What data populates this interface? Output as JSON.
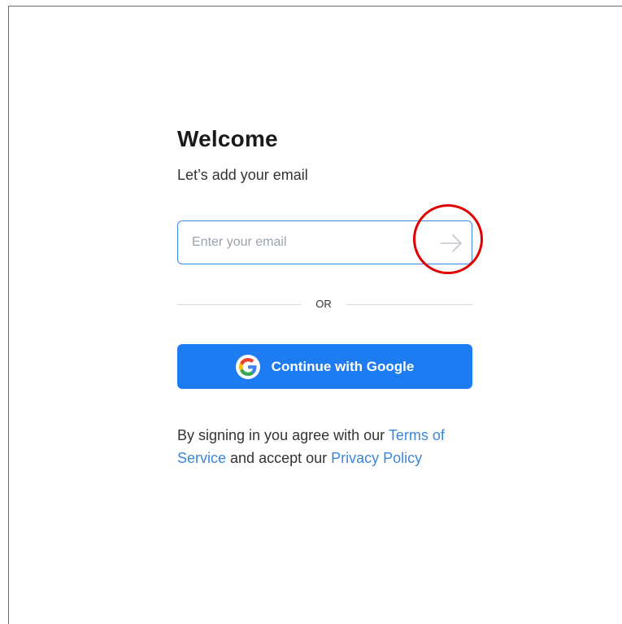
{
  "login": {
    "title": "Welcome",
    "subtitle": "Let’s add your email",
    "email_placeholder": "Enter your email",
    "email_value": "",
    "divider_text": "OR",
    "google_button_label": "Continue with Google",
    "legal": {
      "prefix": "By signing in you agree with our ",
      "terms_link": "Terms of Service",
      "middle": " and accept our ",
      "privacy_link": "Privacy Policy"
    }
  },
  "icons": {
    "submit": "arrow-right-icon",
    "google": "google-g-icon"
  },
  "colors": {
    "primary_button": "#1e7cf2",
    "input_border": "#3d8ce6",
    "link": "#3a86d8",
    "annotation": "#e00000",
    "google_red": "#ea4335",
    "google_yellow": "#fbbc05",
    "google_green": "#34a853",
    "google_blue": "#4285f4"
  }
}
